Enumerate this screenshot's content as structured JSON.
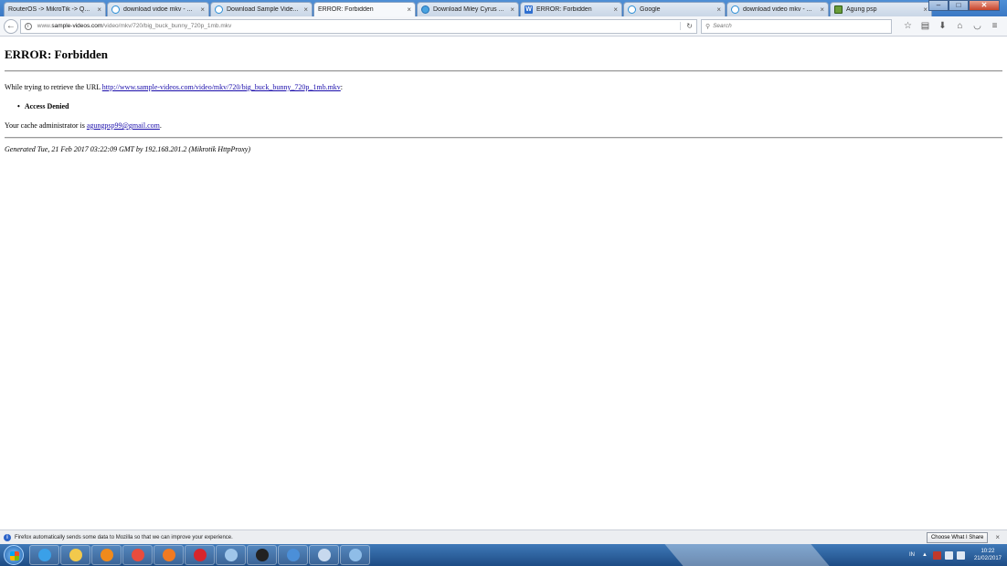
{
  "browser": {
    "tabs": [
      {
        "title": "RouterOS -> MikroTik -> Q...",
        "favicon": "none"
      },
      {
        "title": "download vidoe mkv - ...",
        "favicon": "google-icon"
      },
      {
        "title": "Download Sample Vide...",
        "favicon": "google-icon"
      },
      {
        "title": "ERROR: Forbidden",
        "favicon": "none",
        "active": true
      },
      {
        "title": "Download Miley Cyrus ...",
        "favicon": "globe-icon"
      },
      {
        "title": "ERROR: Forbidden",
        "favicon": "w-icon"
      },
      {
        "title": "Google",
        "favicon": "google-icon"
      },
      {
        "title": "download video mkv - ...",
        "favicon": "google-icon"
      },
      {
        "title": "Agung psp",
        "favicon": "image-icon"
      }
    ],
    "tab_close": "×",
    "new_tab": "+",
    "url_host": "www.sample-videos.com",
    "url_path": "/video/mkv/720/big_buck_bunny_720p_1mb.mkv",
    "url_prefix": "www.",
    "url_domain": "sample-videos.com",
    "search_placeholder": "Search"
  },
  "page": {
    "title": "ERROR: Forbidden",
    "retrieve_text": "While trying to retrieve the URL ",
    "retrieve_url": "http://www.sample-videos.com/video/mkv/720/big_buck_bunny_720p_1mb.mkv",
    "retrieve_suffix": ":",
    "reason": "Access Denied",
    "admin_text": "Your cache administrator is ",
    "admin_email": "agungpsp99@gmail.com",
    "admin_suffix": ".",
    "generated": "Generated Tue, 21 Feb 2017 03:22:09 GMT by 192.168.201.2 (Mikrotik HttpProxy)"
  },
  "notification": {
    "message": "Firefox automatically sends some data to Mozilla so that we can improve your experience.",
    "button": "Choose What I Share",
    "close": "×"
  },
  "taskbar": {
    "lang": "IN",
    "time": "10:22",
    "date": "21/02/2017",
    "apps": [
      {
        "name": "ie-icon",
        "color": "#3aa0e8"
      },
      {
        "name": "explorer-icon",
        "color": "#f2c94c"
      },
      {
        "name": "outlook-icon",
        "color": "#f08a1c"
      },
      {
        "name": "chrome-icon",
        "color": "#e84c3d"
      },
      {
        "name": "firefox-icon",
        "color": "#f07a22"
      },
      {
        "name": "opera-icon",
        "color": "#d8262c"
      },
      {
        "name": "network-icon",
        "color": "#9fc6ea"
      },
      {
        "name": "cmd-icon",
        "color": "#222222"
      },
      {
        "name": "remote-icon",
        "color": "#4b8fd8"
      },
      {
        "name": "search-tool-icon",
        "color": "#c7d9ee"
      },
      {
        "name": "paint-icon",
        "color": "#8fbde8"
      }
    ]
  }
}
